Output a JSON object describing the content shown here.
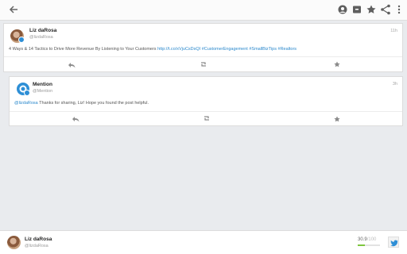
{
  "appbar": {
    "back_icon": "arrow-left-icon",
    "actions": [
      "avatar-icon",
      "archive-icon",
      "star-icon",
      "share-icon",
      "more-vert-icon"
    ]
  },
  "tweet": {
    "author_name": "Liz daRosa",
    "author_handle": "@lizdaRosa",
    "time": "11h",
    "text_plain": "4 Ways & 14 Tactics to Drive More Revenue By Listening to Your Customers ",
    "text_links": "http://t.co/xVjuCsDsQI #CustomerEngagement #SmallBizTips #Realtors"
  },
  "reply": {
    "author_name": "Mention",
    "author_handle": "@Mention",
    "time": "3h",
    "mention": "@lizdaRosa",
    "text": " Thanks for sharing, Liz! Hope you found the post helpful."
  },
  "composer": {
    "account_name": "Liz daRosa",
    "account_handle": "@lizdaRosa",
    "count": "30.9",
    "count_max": "/100",
    "progress_fraction": 0.309
  },
  "colors": {
    "link": "#2a88cc",
    "twitter_blue": "#2e8fd6",
    "progress_green": "#7ec63f"
  }
}
